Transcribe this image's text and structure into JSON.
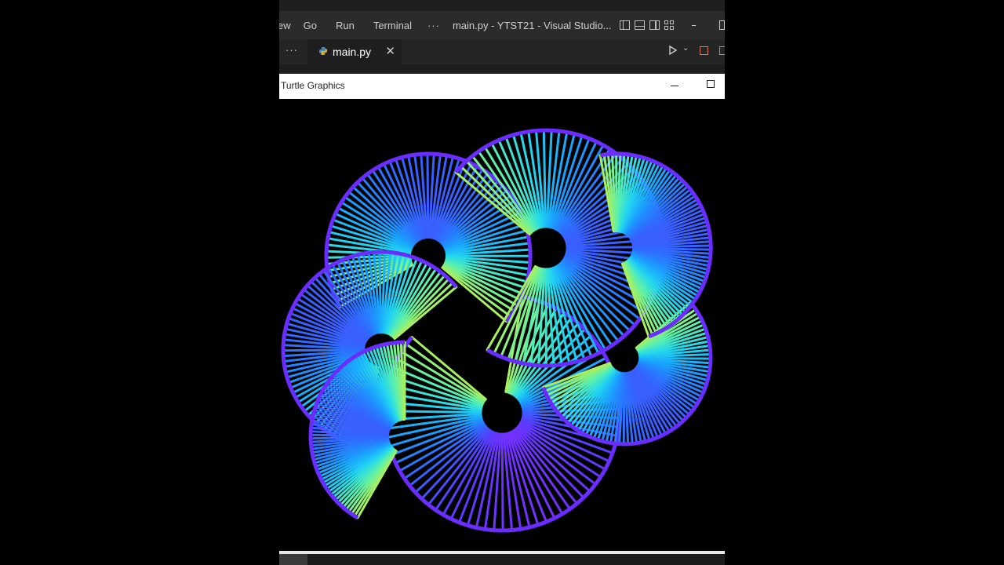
{
  "vscode": {
    "menu": [
      "ew",
      "Go",
      "Run",
      "Terminal"
    ],
    "more": "···",
    "window_title": "main.py - YTST21 - Visual Studio...",
    "tab": {
      "more": "···",
      "label": "main.py",
      "close": "✕",
      "icon": "python-file-icon"
    },
    "run_icon": "play-icon",
    "colors": {
      "titlebar": "#2b2b2b",
      "tabbar": "#252526",
      "editor": "#1e1e1e"
    }
  },
  "turtle": {
    "title": "Turtle Graphics",
    "icons": [
      "minimize-icon",
      "maximize-icon"
    ],
    "palette": [
      "#7b2cff",
      "#5a3cff",
      "#2f6bff",
      "#1aa2ff",
      "#22d6f0",
      "#58f0b0",
      "#a8f060"
    ]
  }
}
